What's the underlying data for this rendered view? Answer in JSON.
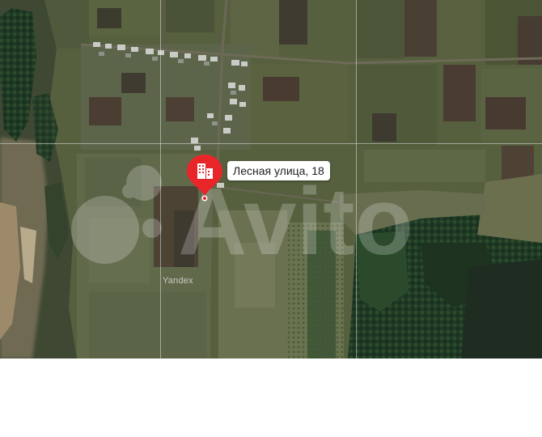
{
  "map": {
    "type": "satellite",
    "marker": {
      "label": "Лесная улица, 18",
      "icon": "building-icon",
      "color": "#e8262a"
    },
    "attribution": "Yandex",
    "watermark": "Avito"
  }
}
